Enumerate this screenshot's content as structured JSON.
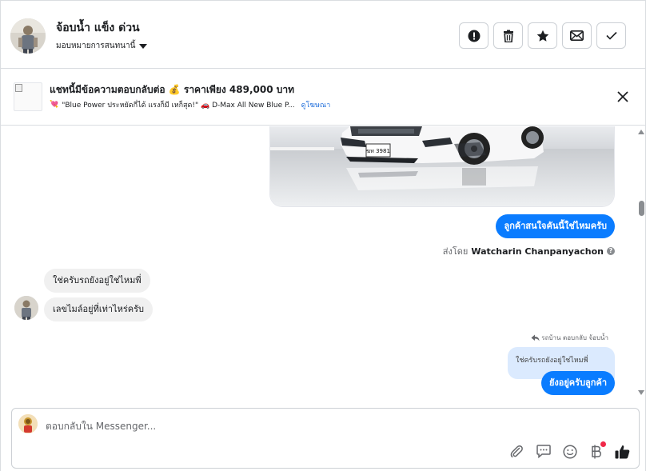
{
  "header": {
    "name": "จ้อบน้ำ แข็ง ด่วน",
    "assign_label": "มอบหมายการสนทนานี้",
    "actions": [
      {
        "icon": "alert-icon",
        "label": "spam"
      },
      {
        "icon": "trash-icon",
        "label": "delete"
      },
      {
        "icon": "star-icon",
        "label": "follow-up"
      },
      {
        "icon": "mail-icon",
        "label": "mark unread"
      },
      {
        "icon": "check-icon",
        "label": "done"
      }
    ]
  },
  "banner": {
    "title": "แชทนี้มีข้อความตอบกลับต่อ 💰 ราคาเพียง 489,000 บาท",
    "sub_emoji": "💘",
    "sub_text": "\"Blue Power ประหยัดกี่ได้ แรงก็มี เหก็สุด!\" 🚗 D-Max All New Blue P...",
    "link": "ดูโฆษณา"
  },
  "messages": {
    "out_1": "ลูกค้าสนใจคันนี้ใช่ไหมครับ",
    "sent_by_prefix": "ส่งโดย",
    "sent_by_name": "Watcharin Chanpanyachon",
    "in_1": "ใช่ครับรถยังอยู่ใช่ไหมพี่",
    "in_2": "เลขไมล์อยู่ที่เท่าไหร่ครับ",
    "reply_meta": "รถบ้าน ตอบกลับ จ้อบน้ำ",
    "quoted": "ใช่ครับรถยังอยู่ใช่ไหมพี่",
    "out_2": "ยังอยู่ครับลูกค้า"
  },
  "car_photo": {
    "plate": "ฆท 3981"
  },
  "composer": {
    "placeholder": "ตอบกลับใน Messenger..."
  },
  "colors": {
    "accent": "#0a7cff",
    "link": "#216fdb",
    "incoming_bubble": "#f0f0f0",
    "quoted_bubble": "#dbeafe"
  }
}
